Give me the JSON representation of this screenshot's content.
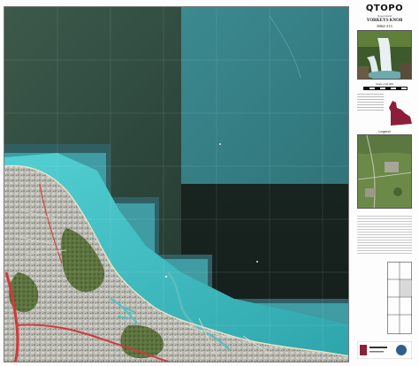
{
  "panel": {
    "brand": "QTOPO",
    "subtitle": "Queensland",
    "sheet_name": "YORKEYS KNOB",
    "sheet_code": "8064-313",
    "scale_text": "Scale 1:10,000",
    "legend_title": "Legend"
  },
  "colors": {
    "sea_deep": "#2c4a40",
    "sea_dark": "#1a2a24",
    "sea_teal": "#3e8f95",
    "shallow": "#46c5c8",
    "land_urban": "#b8b7b3",
    "land_green": "#5e7a3c",
    "road": "#d2383a",
    "queensland_maroon": "#8b1f3b"
  },
  "icons": [
    "waterfall-photo",
    "queensland-locator-icon",
    "legend-image",
    "map-index-grid",
    "agency-logos"
  ]
}
